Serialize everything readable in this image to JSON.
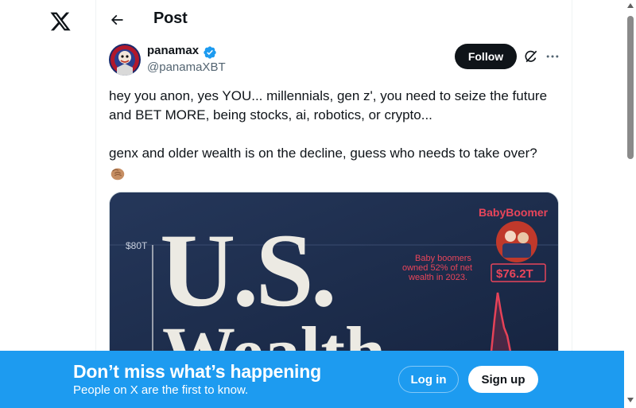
{
  "nav": {
    "logo_icon": "x-logo-icon",
    "back_icon": "arrow-left-icon"
  },
  "header": {
    "title": "Post"
  },
  "post": {
    "author": {
      "display_name": "panamax",
      "handle": "@panamaXBT",
      "verified": true,
      "verified_color": "#1d9bf0"
    },
    "follow_label": "Follow",
    "text_line_1": "hey you anon, yes YOU... millennials, gen z', you need to seize the future and BET MORE, being stocks, ai, robotics, or crypto...",
    "text_line_2": "genx and older wealth is on the decline, guess who needs to take over?",
    "emoji": "fist-bump-emoji",
    "media": {
      "title_line_1": "U.S.",
      "title_line_2": "Wealth",
      "axis_tick": "$80T",
      "series_label": "BabyBoomer",
      "annotation_1": "Baby boomers",
      "annotation_2": "owned 52% of net",
      "annotation_3": "wealth in 2023.",
      "value_badge": "$76.2T"
    }
  },
  "banner": {
    "title": "Don’t miss what’s happening",
    "subtitle": "People on X are the first to know.",
    "login_label": "Log in",
    "signup_label": "Sign up",
    "background": "#1d9bf0"
  }
}
